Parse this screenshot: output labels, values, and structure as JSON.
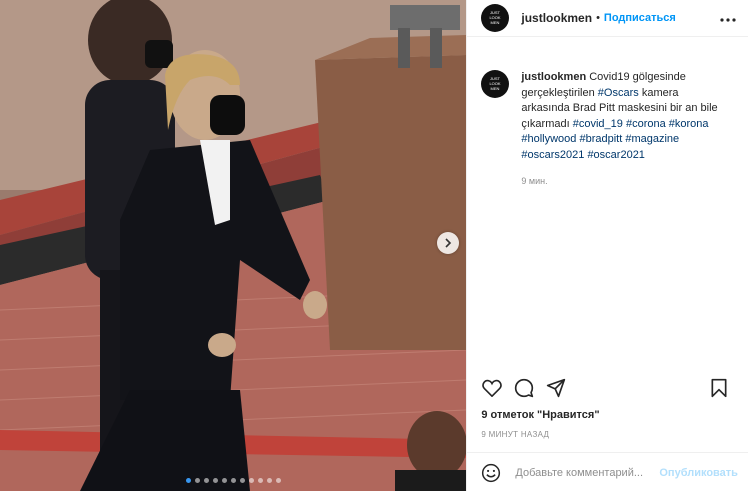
{
  "header": {
    "username": "justlookmen",
    "separator": "•",
    "follow_label": "Подписаться",
    "more_icon": "more-horizontal-icon"
  },
  "avatar": {
    "logo_lines": [
      "JUST",
      "LOOK",
      "MEN"
    ]
  },
  "caption": {
    "username": "justlookmen",
    "parts": [
      {
        "text": "Covid19 gölgesinde gerçekleştirilen ",
        "tag": false
      },
      {
        "text": "#Oscars",
        "tag": true
      },
      {
        "text": " kamera arkasında Brad Pitt maskesini bir an bile çıkarmadı ",
        "tag": false
      },
      {
        "text": "#covid_19",
        "tag": true
      },
      {
        "text": " ",
        "tag": false
      },
      {
        "text": "#corona",
        "tag": true
      },
      {
        "text": " ",
        "tag": false
      },
      {
        "text": "#korona",
        "tag": true
      },
      {
        "text": " ",
        "tag": false
      },
      {
        "text": "#hollywood",
        "tag": true
      },
      {
        "text": " ",
        "tag": false
      },
      {
        "text": "#bradpitt",
        "tag": true
      },
      {
        "text": " ",
        "tag": false
      },
      {
        "text": "#magazine",
        "tag": true
      },
      {
        "text": " ",
        "tag": false
      },
      {
        "text": "#oscars2021",
        "tag": true
      },
      {
        "text": " ",
        "tag": false
      },
      {
        "text": "#oscar2021",
        "tag": true
      }
    ],
    "time": "9 мин."
  },
  "actions": {
    "like_icon": "heart-icon",
    "comment_icon": "comment-icon",
    "share_icon": "share-icon",
    "save_icon": "bookmark-icon"
  },
  "likes": "9 отметок \"Нравится\"",
  "timestamp": "9 МИНУТ НАЗАД",
  "comment": {
    "placeholder": "Добавьте комментарий...",
    "publish_label": "Опубликовать",
    "emoji_icon": "emoji-icon"
  },
  "carousel": {
    "slide_count": 11,
    "active_index": 0,
    "next_icon": "chevron-right-icon"
  },
  "colors": {
    "link": "#0095f6",
    "hashtag": "#00376b",
    "muted": "#8e8e8e",
    "publish_disabled": "#b2dffc"
  }
}
